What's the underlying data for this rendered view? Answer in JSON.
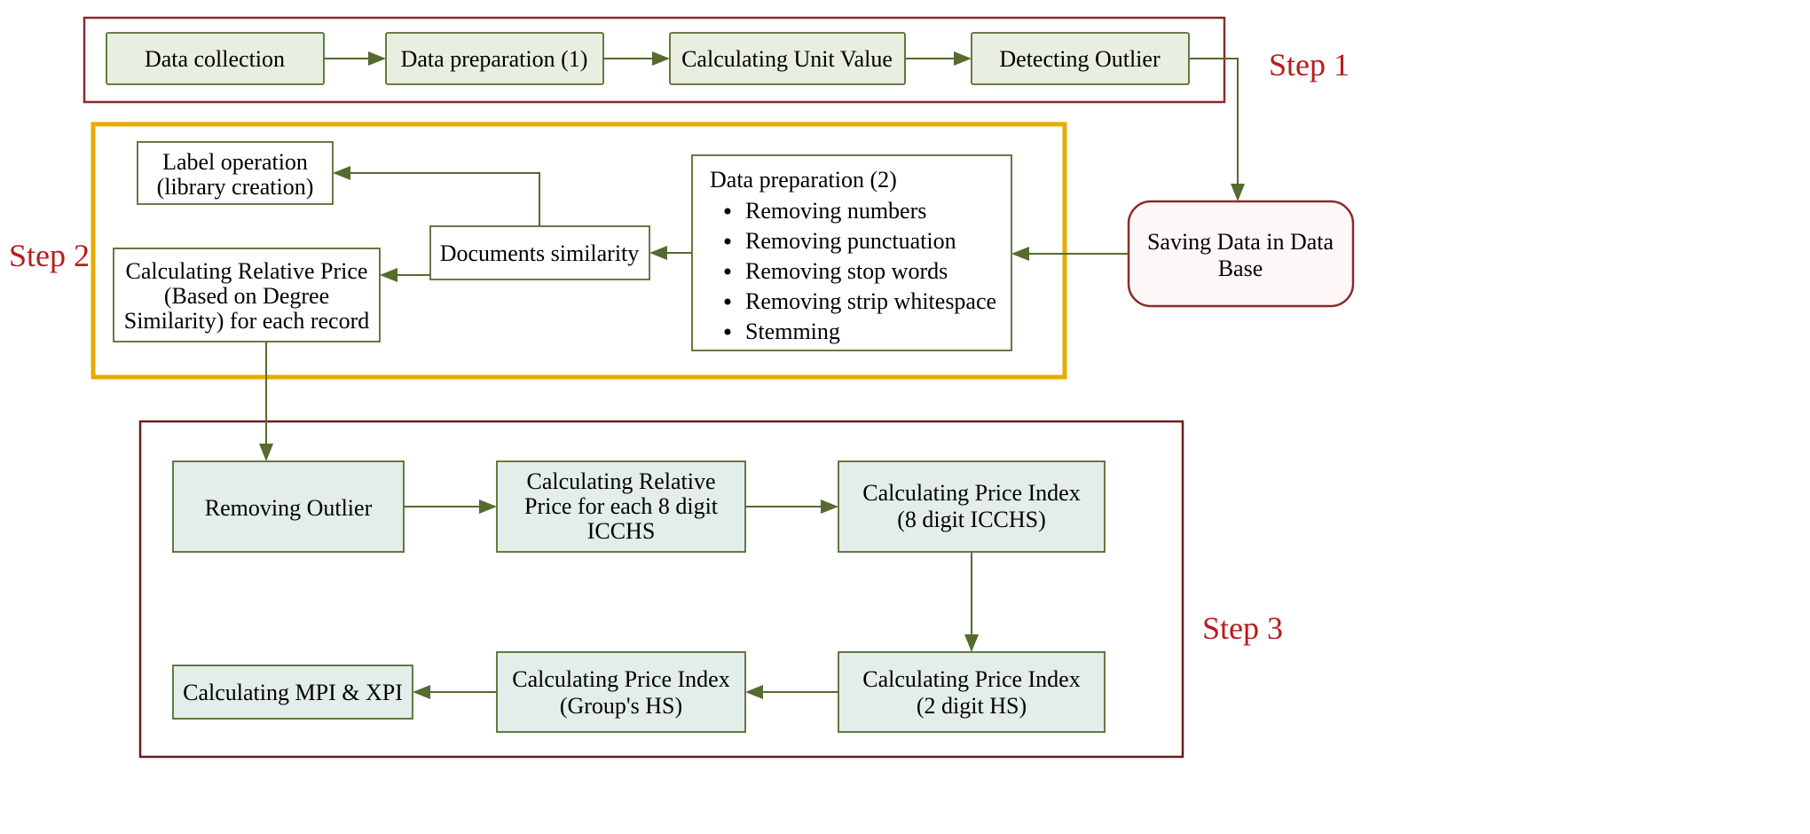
{
  "steps": {
    "step1": {
      "label": "Step 1"
    },
    "step2": {
      "label": "Step 2"
    },
    "step3": {
      "label": "Step 3"
    }
  },
  "nodes": {
    "s1a": {
      "text": "Data collection"
    },
    "s1b": {
      "text": "Data preparation (1)"
    },
    "s1c": {
      "text": "Calculating Unit Value"
    },
    "s1d": {
      "text": "Detecting Outlier"
    },
    "db": {
      "l1": "Saving Data in Data",
      "l2": "Base"
    },
    "s2prep": {
      "title": "Data preparation (2)",
      "b1": "Removing numbers",
      "b2": "Removing punctuation",
      "b3": "Removing stop words",
      "b4": "Removing strip whitespace",
      "b5": "Stemming"
    },
    "s2sim": {
      "text": "Documents similarity"
    },
    "s2lab": {
      "l1": "Label operation",
      "l2": "(library creation)"
    },
    "s2rel": {
      "l1": "Calculating Relative Price",
      "l2": "(Based on Degree",
      "l3": "Similarity) for each record"
    },
    "s3a": {
      "text": "Removing Outlier"
    },
    "s3b": {
      "l1": "Calculating Relative",
      "l2": "Price for each 8 digit",
      "l3": "ICCHS"
    },
    "s3c": {
      "l1": "Calculating Price Index",
      "l2": "(8 digit ICCHS)"
    },
    "s3d": {
      "l1": "Calculating Price Index",
      "l2": "(2 digit HS)"
    },
    "s3e": {
      "l1": "Calculating Price Index",
      "l2": "(Group's HS)"
    },
    "s3f": {
      "text": "Calculating MPI & XPI"
    }
  },
  "colors": {
    "step1_border": "#8a2b2b",
    "step2_border": "#e6ac00",
    "step3_border": "#6b1d1d",
    "box_green_fill": "#e8efe0",
    "box_teal_fill": "#e3edea",
    "box_white_fill": "#ffffff",
    "box_stroke": "#556b2f",
    "db_fill": "#fdf7f7",
    "db_stroke": "#8a2b2b",
    "arrow": "#556b2f"
  }
}
